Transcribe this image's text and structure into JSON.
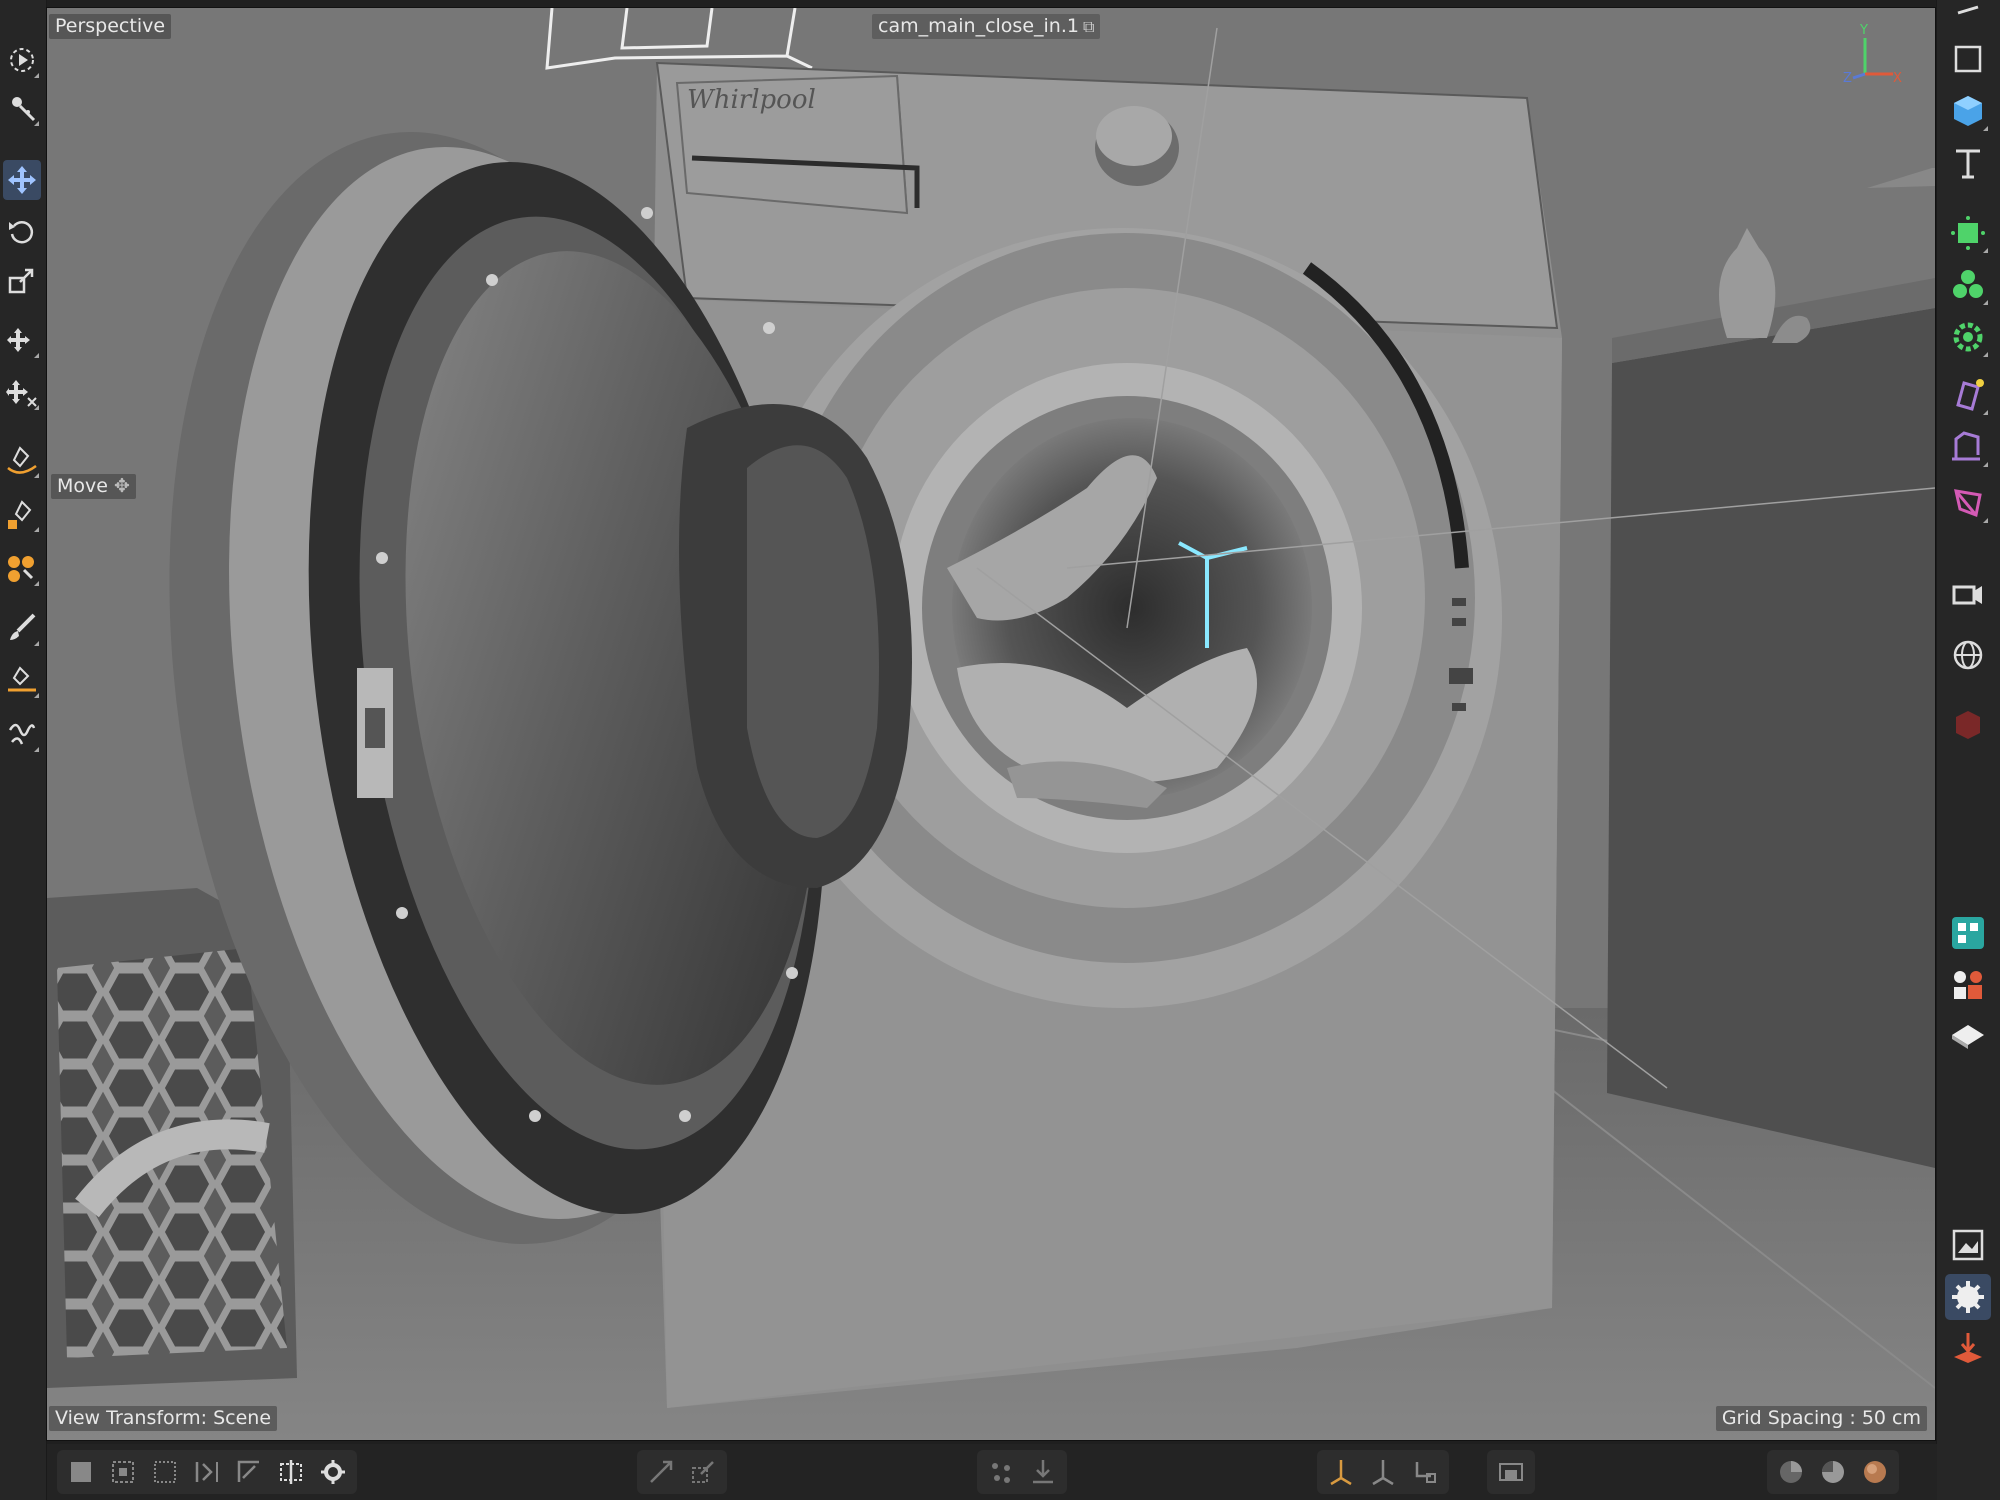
{
  "viewport": {
    "view_name": "Perspective",
    "camera_name": "cam_main_close_in.1",
    "tool_hint": "Move",
    "view_transform": "View Transform: Scene",
    "grid_spacing": "Grid Spacing : 50 cm",
    "axis_labels": {
      "y": "Y",
      "z": "Z",
      "x": "X"
    },
    "brand_text": "Whirlpool"
  },
  "left_toolbar": {
    "tools": [
      {
        "name": "select-icon",
        "active": false
      },
      {
        "name": "live-selection-icon",
        "active": false
      },
      {
        "name": "move-icon",
        "active": true
      },
      {
        "name": "rotate-icon",
        "active": false
      },
      {
        "name": "scale-icon",
        "active": false
      },
      {
        "name": "transfer-icon",
        "active": false
      },
      {
        "name": "placement-icon",
        "active": false
      },
      {
        "name": "spline-pen-icon",
        "active": false
      },
      {
        "name": "sketch-icon",
        "active": false
      },
      {
        "name": "spline-smooth-icon",
        "active": false
      },
      {
        "name": "brush-icon",
        "active": false
      },
      {
        "name": "knife-icon",
        "active": false
      },
      {
        "name": "sculpt-icon",
        "active": false
      }
    ]
  },
  "right_toolbar": {
    "tools": [
      {
        "name": "null-object-icon"
      },
      {
        "name": "cube-icon"
      },
      {
        "name": "text-tool-icon"
      },
      {
        "name": "generator-icon"
      },
      {
        "name": "subdivision-icon"
      },
      {
        "name": "mograph-cloner-icon"
      },
      {
        "name": "deformer-icon"
      },
      {
        "name": "field-icon"
      },
      {
        "name": "tag-icon"
      },
      {
        "name": "camera-icon"
      },
      {
        "name": "environment-icon"
      },
      {
        "name": "render-icon"
      },
      {
        "name": "layout-icon"
      },
      {
        "name": "mograph-icon"
      },
      {
        "name": "floor-icon"
      },
      {
        "name": "picture-viewer-icon"
      },
      {
        "name": "render-settings-icon"
      },
      {
        "name": "import-icon"
      }
    ]
  },
  "colors": {
    "active_tool_bg": "#3a4a63",
    "accent_green": "#4fd36a",
    "accent_red": "#e05a3a",
    "accent_cyan": "#8ae8ff",
    "accent_purple": "#a77bd6",
    "viewport_bg": "#747474"
  }
}
